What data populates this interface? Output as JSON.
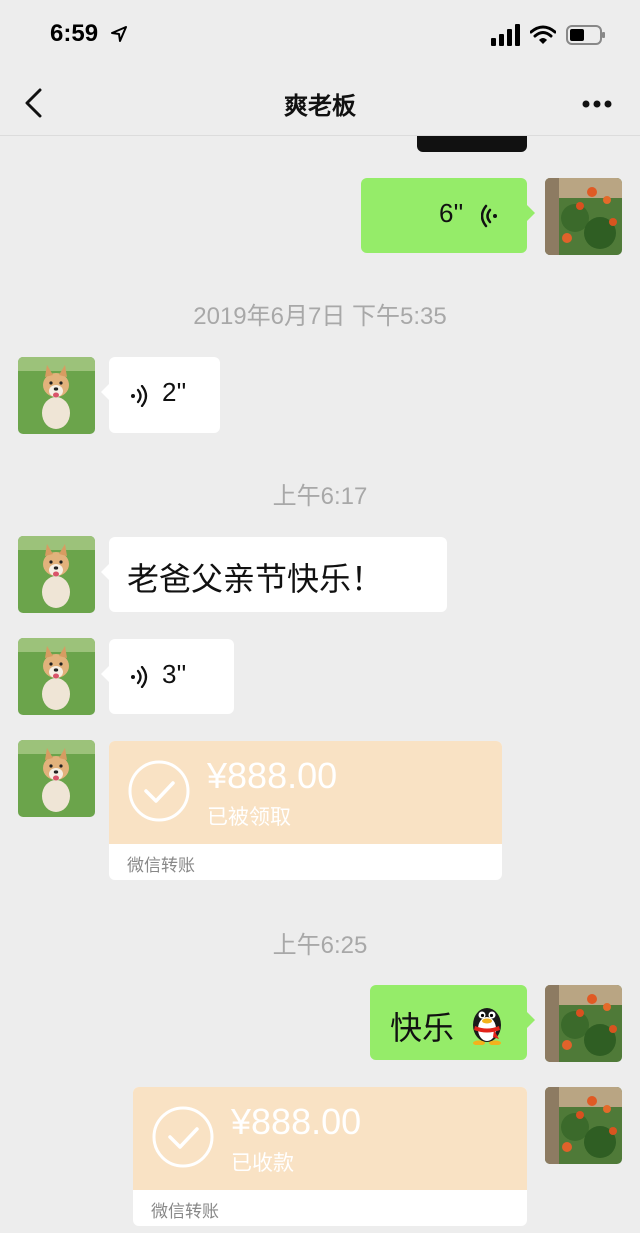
{
  "status_bar": {
    "time": "6:59",
    "icons": [
      "location-arrow-icon",
      "signal-icon",
      "wifi-icon",
      "battery-icon"
    ]
  },
  "nav": {
    "title": "爽老板",
    "back_icon": "chevron-left-icon",
    "more_icon": "more-icon"
  },
  "messages": {
    "voice_6": "6''",
    "timestamp_1": "2019年6月7日 下午5:35",
    "voice_2": "2''",
    "timestamp_2": "上午6:17",
    "text_fathers_day": "老爸父亲节快乐！",
    "voice_3": "3''",
    "transfer_1": {
      "amount": "¥888.00",
      "status": "已被领取",
      "label": "微信转账"
    },
    "timestamp_3": "上午6:25",
    "text_happy": "快乐",
    "emoji": "qq-penguin-emoji",
    "transfer_2": {
      "amount": "¥888.00",
      "status": "已收款",
      "label": "微信转账"
    }
  },
  "colors": {
    "background": "#ededed",
    "sent_bubble": "#95ec69",
    "received_bubble": "#ffffff",
    "transfer": "#f9e2c4"
  }
}
